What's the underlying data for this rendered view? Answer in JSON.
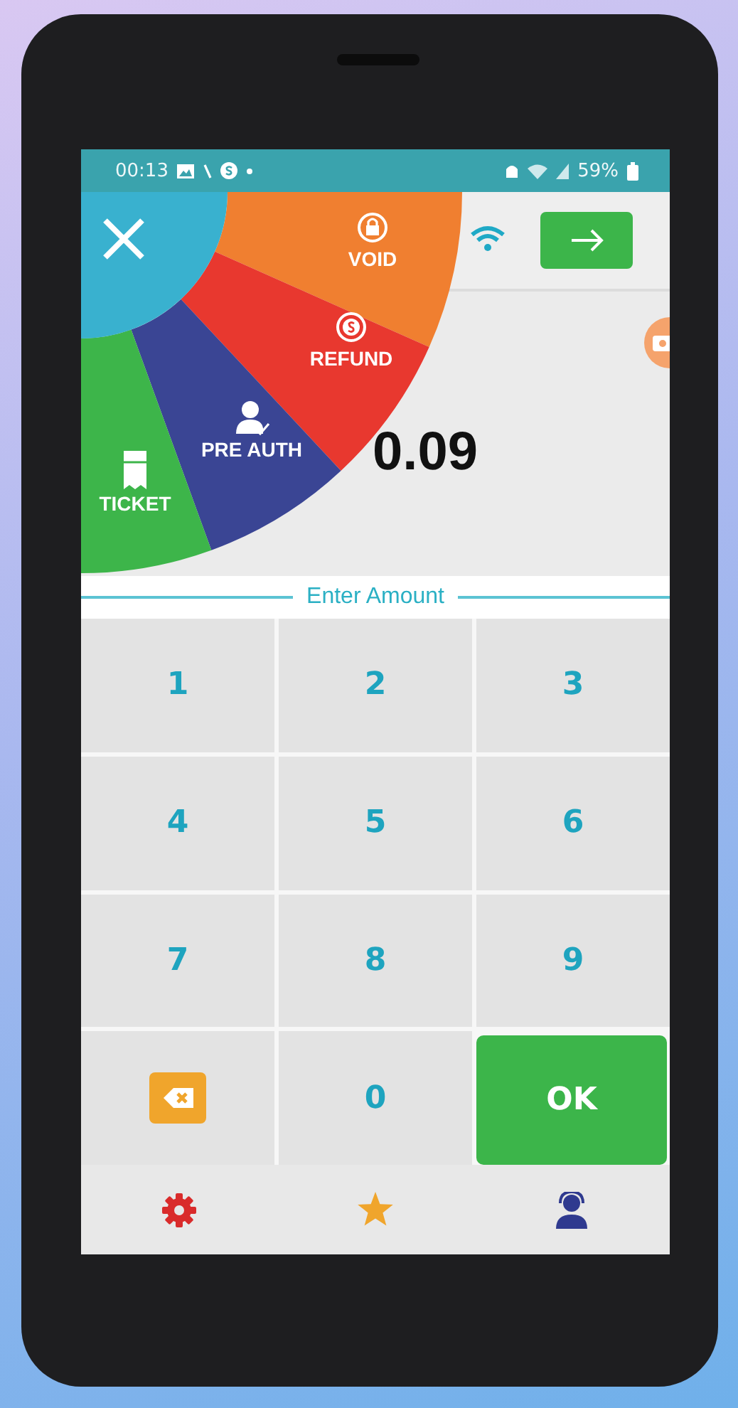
{
  "status_bar": {
    "time": "00:13",
    "battery": "59%"
  },
  "menu": {
    "items": [
      {
        "kind": "void",
        "label": "VOID",
        "color": "#f07f30"
      },
      {
        "kind": "refund",
        "label": "REFUND",
        "color": "#e8382f"
      },
      {
        "kind": "preauth",
        "label": "PRE AUTH",
        "color": "#3a4594"
      },
      {
        "kind": "ticket",
        "label": "TICKET",
        "color": "#3db54a"
      }
    ]
  },
  "amount": "0.09",
  "amount_label": "Enter Amount",
  "keypad": [
    {
      "kind": "digit",
      "label": "1"
    },
    {
      "kind": "digit",
      "label": "2"
    },
    {
      "kind": "digit",
      "label": "3"
    },
    {
      "kind": "digit",
      "label": "4"
    },
    {
      "kind": "digit",
      "label": "5"
    },
    {
      "kind": "digit",
      "label": "6"
    },
    {
      "kind": "digit",
      "label": "7"
    },
    {
      "kind": "digit",
      "label": "8"
    },
    {
      "kind": "digit",
      "label": "9"
    },
    {
      "kind": "backspace"
    },
    {
      "kind": "digit",
      "label": "0"
    },
    {
      "kind": "ok",
      "label": "OK"
    }
  ],
  "bottom_nav": [
    {
      "kind": "settings"
    },
    {
      "kind": "favorites"
    },
    {
      "kind": "support"
    }
  ]
}
